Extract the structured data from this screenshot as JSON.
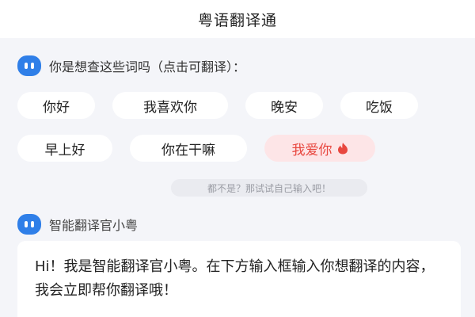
{
  "header": {
    "title": "粤语翻译通"
  },
  "prompt": {
    "text": "你是想查这些词吗（点击可翻译）："
  },
  "phrases": [
    {
      "label": "你好"
    },
    {
      "label": "我喜欢你"
    },
    {
      "label": "晚安"
    },
    {
      "label": "吃饭"
    },
    {
      "label": "早上好"
    },
    {
      "label": "你在干嘛"
    },
    {
      "label": "我爱你",
      "highlighted": true
    }
  ],
  "hint": {
    "text": "都不是？那试试自己输入吧！"
  },
  "bot": {
    "name": "智能翻译官小粤",
    "message": "Hi！我是智能翻译官小粤。在下方输入框输入你想翻译的内容，我会立即帮你翻译哦！"
  },
  "colors": {
    "accent_blue": "#2f7fe8",
    "highlight_bg": "#fde5e7",
    "highlight_text": "#e8473f"
  }
}
